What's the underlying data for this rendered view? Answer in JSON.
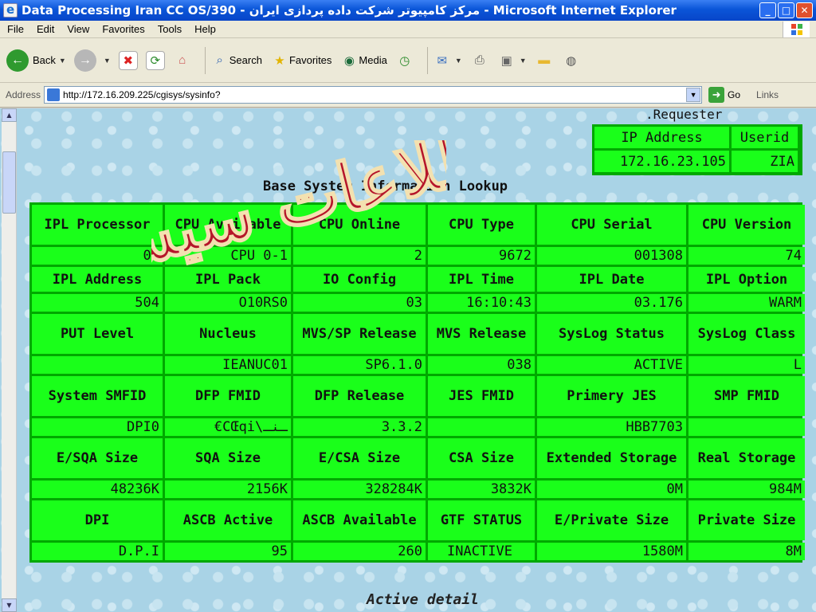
{
  "window": {
    "title": "Data Processing Iran CC OS/390 - مرکز کامپیوتر شرکت داده پردازی ایران - Microsoft Internet Explorer"
  },
  "menu": [
    "File",
    "Edit",
    "View",
    "Favorites",
    "Tools",
    "Help"
  ],
  "toolbar": {
    "back": "Back",
    "search": "Search",
    "favorites": "Favorites",
    "media": "Media"
  },
  "address": {
    "label": "Address",
    "url": "http://172.16.209.225/cgisys/sysinfo?",
    "go": "Go",
    "links": "Links"
  },
  "watermark_text": "اطلاعات سیستم",
  "requester": {
    "title": ".Requester",
    "ip_label": "IP Address",
    "userid_label": "Userid",
    "ip": "172.16.23.105",
    "userid": "ZIA"
  },
  "heading": "Base System Information Lookup",
  "grid": [
    {
      "headers": [
        "IPL Processor",
        "CPU Available",
        "CPU Online",
        "CPU Type",
        "CPU Serial",
        "CPU Version"
      ],
      "values": [
        "00",
        "CPU 0-1",
        "2",
        "9672",
        "001308",
        "74"
      ]
    },
    {
      "headers": [
        "IPL Address",
        "IPL Pack",
        "IO Config",
        "IPL Time",
        "IPL Date",
        "IPL Option"
      ],
      "values": [
        "504",
        "O10RS0",
        "03",
        "16:10:43",
        "03.176",
        "WARM"
      ]
    },
    {
      "headers": [
        "PUT Level",
        "Nucleus",
        "MVS/SP Release",
        "MVS Release",
        "SysLog Status",
        "SysLog Class"
      ],
      "values": [
        "",
        "IEANUC01",
        "SP6.1.0",
        "038",
        "ACTIVE",
        "L"
      ]
    },
    {
      "headers": [
        "System SMFID",
        "DFP FMID",
        "DFP Release",
        "JES FMID",
        "Primery JES",
        "SMP FMID"
      ],
      "values": [
        "DPI0",
        "€CŒqi\\ـنـ",
        "3.3.2",
        "",
        "HBB7703",
        ""
      ]
    },
    {
      "headers": [
        "E/SQA Size",
        "SQA Size",
        "E/CSA Size",
        "CSA Size",
        "Extended Storage",
        "Real Storage"
      ],
      "values": [
        "48236K",
        "2156K",
        "328284K",
        "3832K",
        "0M",
        "984M"
      ]
    },
    {
      "headers": [
        "DPI",
        "ASCB Active",
        "ASCB Available",
        "GTF STATUS",
        "E/Private Size",
        "Private Size"
      ],
      "values": [
        "D.P.I",
        "95",
        "260",
        "INACTIVE",
        "1580M",
        "8M"
      ]
    }
  ],
  "footer": "Active detail"
}
